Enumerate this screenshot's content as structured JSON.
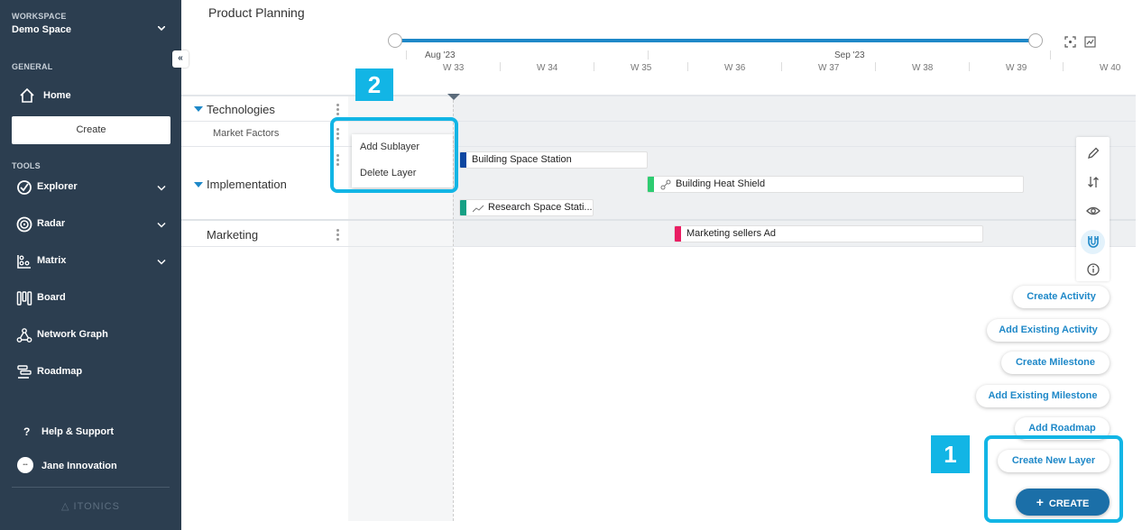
{
  "sidebar": {
    "workspace_label": "WORKSPACE",
    "workspace_name": "Demo Space",
    "general_label": "GENERAL",
    "home": "Home",
    "create": "Create",
    "tools_label": "TOOLS",
    "tools": [
      "Explorer",
      "Radar",
      "Matrix",
      "Board",
      "Network Graph",
      "Roadmap"
    ],
    "help": "Help & Support",
    "user": "Jane Innovation",
    "logo": "ITONICS",
    "collapse": "«"
  },
  "page": {
    "title": "Product Planning"
  },
  "timeline": {
    "months": [
      "Aug '23",
      "Sep '23"
    ],
    "weeks": [
      "W 33",
      "W 34",
      "W 35",
      "W 36",
      "W 37",
      "W 38",
      "W 39",
      "W 40"
    ]
  },
  "layers": {
    "technologies": "Technologies",
    "market_factors": "Market Factors",
    "implementation": "Implementation",
    "marketing": "Marketing"
  },
  "context_menu": {
    "add_sublayer": "Add Sublayer",
    "delete_layer": "Delete Layer"
  },
  "bars": {
    "space_station": "Building Space Station",
    "heat_shield": "Building Heat Shield",
    "research": "Research Space Stati...",
    "marketing_ad": "Marketing sellers Ad"
  },
  "colors": {
    "space_station": "#0d47a1",
    "heat_shield": "#2ecc71",
    "research": "#16a085",
    "marketing_ad": "#e91e63",
    "accent": "#1e88c8",
    "highlight": "#12b5e5"
  },
  "fab_menu": {
    "create_activity": "Create Activity",
    "add_existing_activity": "Add Existing Activity",
    "create_milestone": "Create Milestone",
    "add_existing_milestone": "Add Existing Milestone",
    "add_roadmap": "Add Roadmap",
    "create_new_layer": "Create New Layer",
    "create_button": "CREATE",
    "plus": "+"
  },
  "annotations": {
    "badge_1": "1",
    "badge_2": "2"
  },
  "icons": [
    "home-icon",
    "explorer-icon",
    "radar-icon",
    "matrix-icon",
    "board-icon",
    "network-graph-icon",
    "roadmap-icon",
    "help-icon",
    "pencil-icon",
    "sort-icon",
    "eye-icon",
    "magnet-icon",
    "info-icon",
    "focus-icon",
    "chart-icon"
  ]
}
